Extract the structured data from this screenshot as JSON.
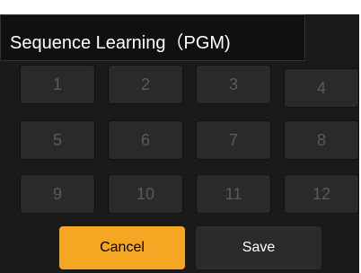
{
  "dialog": {
    "title": "Sequence Learning（PGM)"
  },
  "grid": {
    "cells": [
      "1",
      "2",
      "3",
      "4",
      "5",
      "6",
      "7",
      "8",
      "9",
      "10",
      "11",
      "12"
    ]
  },
  "buttons": {
    "cancel_label": "Cancel",
    "save_label": "Save"
  },
  "colors": {
    "accent": "#f5a623",
    "background": "#1a1a1a",
    "cell": "#2a2a2a"
  }
}
